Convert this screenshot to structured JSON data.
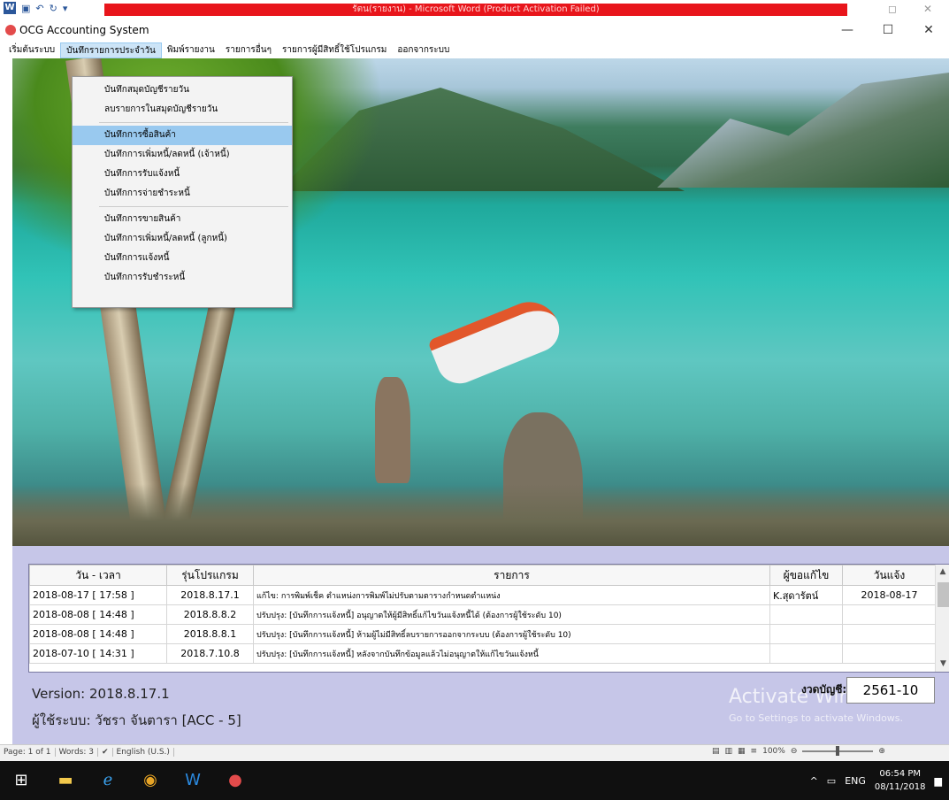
{
  "word": {
    "title": "รัตน(รายงาน) - Microsoft Word (Product Activation Failed)",
    "status": {
      "page": "Page: 1 of 1",
      "words": "Words: 3",
      "language": "English (U.S.)",
      "zoom": "100%"
    }
  },
  "app": {
    "title": "OCG Accounting System"
  },
  "menubar": [
    {
      "label": "เริ่มต้นระบบ"
    },
    {
      "label": "บันทึกรายการประจำวัน"
    },
    {
      "label": "พิมพ์รายงาน"
    },
    {
      "label": "รายการอื่นๆ"
    },
    {
      "label": "รายการผู้มีสิทธิ์ใช้โปรแกรม"
    },
    {
      "label": "ออกจากระบบ"
    }
  ],
  "dropdown": {
    "group1": [
      {
        "label": "บันทึกสมุดบัญชีรายวัน"
      },
      {
        "label": "ลบรายการในสมุดบัญชีรายวัน"
      }
    ],
    "group2": [
      {
        "label": "บันทึกการซื้อสินค้า"
      },
      {
        "label": "บันทึกการเพิ่มหนี้/ลดหนี้ (เจ้าหนี้)"
      },
      {
        "label": "บันทึกการรับแจ้งหนี้"
      },
      {
        "label": "บันทึกการจ่ายชำระหนี้"
      }
    ],
    "group3": [
      {
        "label": "บันทึกการขายสินค้า"
      },
      {
        "label": "บันทึกการเพิ่มหนี้/ลดหนี้ (ลูกหนี้)"
      },
      {
        "label": "บันทึกการแจ้งหนี้"
      },
      {
        "label": "บันทึกการรับชำระหนี้"
      }
    ]
  },
  "table": {
    "headers": [
      "วัน - เวลา",
      "รุ่นโปรแกรม",
      "รายการ",
      "ผู้ขอแก้ไข",
      "วันแจ้ง"
    ],
    "rows": [
      {
        "datetime": "2018-08-17  [ 17:58 ]",
        "version": "2018.8.17.1",
        "desc": "แก้ไข: การพิมพ์เช็ค ตำแหน่งการพิมพ์ไม่ปรับตามตารางกำหนดตำแหน่ง",
        "requester": "K.สุดารัตน์",
        "date": "2018-08-17"
      },
      {
        "datetime": "2018-08-08  [ 14:48 ]",
        "version": "2018.8.8.2",
        "desc": "ปรับปรุง: [บันทึกการแจ้งหนี้] อนุญาตให้ผู้มีสิทธิ์แก้ไขวันแจ้งหนี้ได้ (ต้องการผู้ใช้ระดับ 10)",
        "requester": "",
        "date": ""
      },
      {
        "datetime": "2018-08-08  [ 14:48 ]",
        "version": "2018.8.8.1",
        "desc": "ปรับปรุง: [บันทึกการแจ้งหนี้] ห้ามผู้ไม่มีสิทธิ์ลบรายการออกจากระบบ (ต้องการผู้ใช้ระดับ 10)",
        "requester": "",
        "date": ""
      },
      {
        "datetime": "2018-07-10  [ 14:31 ]",
        "version": "2018.7.10.8",
        "desc": "ปรับปรุง: [บันทึกการแจ้งหนี้] หลังจากบันทึกข้อมูลแล้วไม่อนุญาตให้แก้ไขวันแจ้งหนี้",
        "requester": "",
        "date": ""
      }
    ]
  },
  "footer": {
    "version_label": "Version:  2018.8.17.1",
    "user_label": "ผู้ใช้ระบบ:  วัชรา จันตารา  [ACC - 5]",
    "period_label": "งวดบัญชี:",
    "period_value": "2561-10",
    "activate_title": "Activate Windows",
    "activate_sub": "Go to Settings to activate Windows."
  },
  "taskbar": {
    "lang": "ENG",
    "time": "06:54 PM",
    "date": "08/11/2018"
  },
  "icons": {
    "start": "windows-start-icon",
    "explorer": "file-explorer-icon",
    "ie": "internet-explorer-icon",
    "chrome": "chrome-icon",
    "word": "word-icon",
    "ocg": "ocg-app-icon"
  }
}
